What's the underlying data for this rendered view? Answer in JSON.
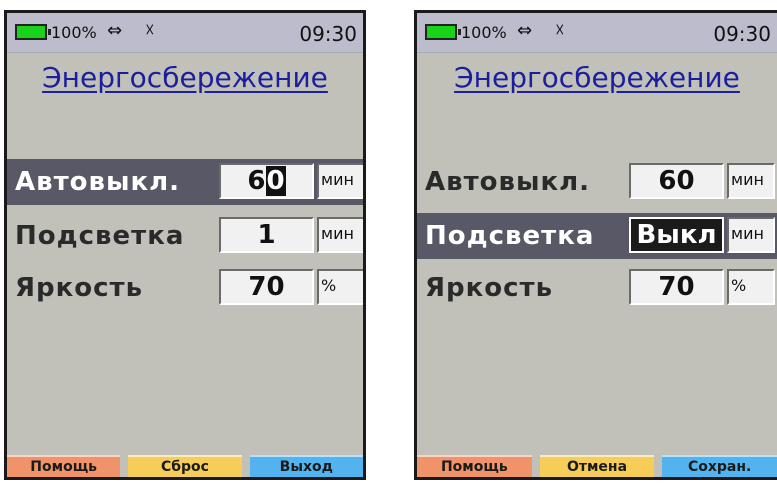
{
  "colors": {
    "screen_bg": "#c1c1ba",
    "statusbar_bg": "#bcbccc",
    "title": "#1b1f9e",
    "selected_row": "#585866",
    "battery": "#19d31a",
    "softkey_help": "#f0936a",
    "softkey_middle": "#f6cd59",
    "softkey_right": "#53b3ef"
  },
  "screens": [
    {
      "status": {
        "battery": "100%",
        "usb_icon": "usb-icon",
        "sensor_icon": "sensor-icon",
        "time": "09:30"
      },
      "title": "Энергосбережение",
      "selected_row": "auto_off",
      "rows": [
        {
          "label": "Автовыкл.",
          "value": "6",
          "cursor": "0",
          "unit": "мин"
        },
        {
          "label": "Подсветка",
          "value": "1",
          "unit": "мин"
        },
        {
          "label": "Яркость",
          "value": "70",
          "unit": "%"
        }
      ],
      "softkeys": [
        "Помощь",
        "Сброс",
        "Выход"
      ]
    },
    {
      "status": {
        "battery": "100%",
        "usb_icon": "usb-icon",
        "sensor_icon": "sensor-icon",
        "time": "09:30"
      },
      "title": "Энергосбережение",
      "selected_row": "backlight",
      "rows": [
        {
          "label": "Автовыкл.",
          "value": "60",
          "unit": "мин"
        },
        {
          "label": "Подсветка",
          "value": "Выкл",
          "unit": "мин"
        },
        {
          "label": "Яркость",
          "value": "70",
          "unit": "%"
        }
      ],
      "softkeys": [
        "Помощь",
        "Отмена",
        "Сохран."
      ]
    }
  ]
}
